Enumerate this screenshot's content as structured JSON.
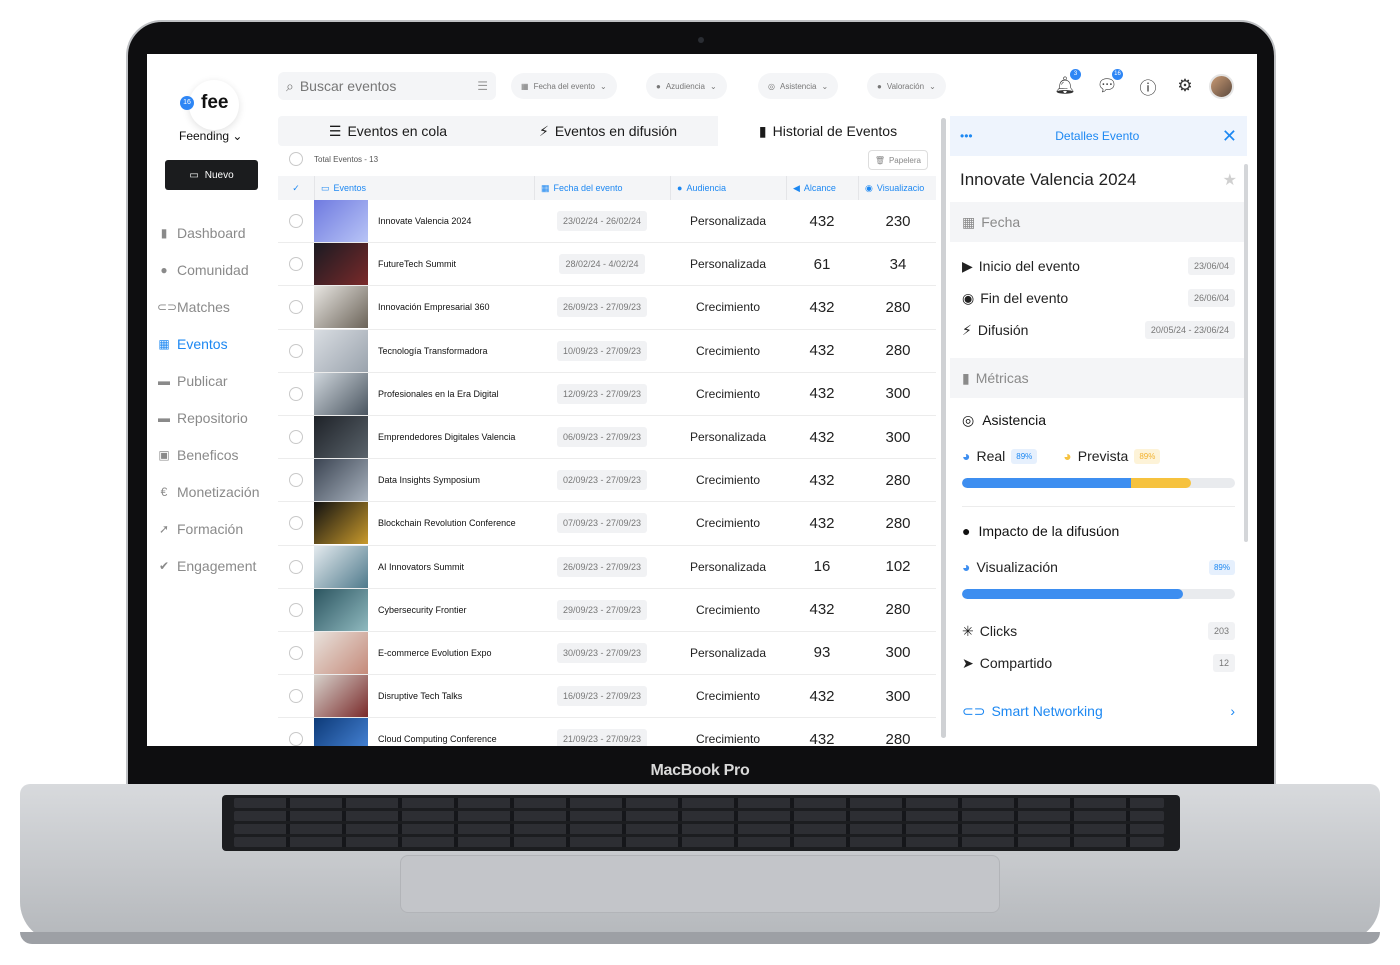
{
  "device": {
    "label": "MacBook Pro"
  },
  "brand": {
    "logo_text": "fee",
    "logo_badge": "16",
    "org_name": "Feending"
  },
  "sidebar": {
    "new_button": "Nuevo",
    "items": [
      {
        "label": "Dashboard",
        "icon": "bar-chart-icon"
      },
      {
        "label": "Comunidad",
        "icon": "users-icon"
      },
      {
        "label": "Matches",
        "icon": "link-icon"
      },
      {
        "label": "Eventos",
        "icon": "calendar-icon",
        "active": true
      },
      {
        "label": "Publicar",
        "icon": "publish-icon"
      },
      {
        "label": "Repositorio",
        "icon": "folder-icon"
      },
      {
        "label": "Beneficos",
        "icon": "gift-icon"
      },
      {
        "label": "Monetización",
        "icon": "euro-icon"
      },
      {
        "label": "Formación",
        "icon": "rocket-icon"
      },
      {
        "label": "Engagement",
        "icon": "shield-check-icon"
      }
    ]
  },
  "topbar": {
    "search_placeholder": "Buscar eventos",
    "filters": [
      "Fecha del evento",
      "Azudiencia",
      "Asistencia",
      "Valoración"
    ],
    "notifications_count": "3",
    "messages_count": "16"
  },
  "tabs": [
    {
      "label": "Eventos en cola",
      "icon": "list-icon"
    },
    {
      "label": "Eventos en difusión",
      "icon": "bolt-icon"
    },
    {
      "label": "Historial de Eventos",
      "icon": "book-icon",
      "active": true
    }
  ],
  "table": {
    "total_label": "Total Eventos - 13",
    "trash_label": "Papelera",
    "columns": [
      "Eventos",
      "Fecha del evento",
      "Audiencia",
      "Alcance",
      "Visualizacio"
    ],
    "rows": [
      {
        "name": "Innovate Valencia 2024",
        "date": "23/02/24 - 26/02/24",
        "audience": "Personalizada",
        "reach": "432",
        "views": "230",
        "color1": "#6f7ae0",
        "color2": "#b8c4f6"
      },
      {
        "name": "FutureTech Summit",
        "date": "28/02/24 - 4/02/24",
        "audience": "Personalizada",
        "reach": "61",
        "views": "34",
        "color1": "#1a1a22",
        "color2": "#7a2a2a"
      },
      {
        "name": "Innovación Empresarial 360",
        "date": "26/09/23 - 27/09/23",
        "audience": "Crecimiento",
        "reach": "432",
        "views": "280",
        "color1": "#e8e6e2",
        "color2": "#6b6358"
      },
      {
        "name": "Tecnología Transformadora",
        "date": "10/09/23 - 27/09/23",
        "audience": "Crecimiento",
        "reach": "432",
        "views": "280",
        "color1": "#d9dde2",
        "color2": "#9aa3ad"
      },
      {
        "name": "Profesionales en la Era Digital",
        "date": "12/09/23 - 27/09/23",
        "audience": "Crecimiento",
        "reach": "432",
        "views": "300",
        "color1": "#cfd6dc",
        "color2": "#4a5560"
      },
      {
        "name": "Emprendedores Digitales Valencia",
        "date": "06/09/23 - 27/09/23",
        "audience": "Personalizada",
        "reach": "432",
        "views": "300",
        "color1": "#1e2228",
        "color2": "#5a636b"
      },
      {
        "name": "Data Insights Symposium",
        "date": "02/09/23 - 27/09/23",
        "audience": "Crecimiento",
        "reach": "432",
        "views": "280",
        "color1": "#3b4452",
        "color2": "#a8b2be"
      },
      {
        "name": "Blockchain Revolution Conference",
        "date": "07/09/23 - 27/09/23",
        "audience": "Crecimiento",
        "reach": "432",
        "views": "280",
        "color1": "#111111",
        "color2": "#c99a2c"
      },
      {
        "name": "AI Innovators Summit",
        "date": "26/09/23 - 27/09/23",
        "audience": "Personalizada",
        "reach": "16",
        "views": "102",
        "color1": "#e4eaee",
        "color2": "#4f7a8c"
      },
      {
        "name": "Cybersecurity Frontier",
        "date": "29/09/23 - 27/09/23",
        "audience": "Crecimiento",
        "reach": "432",
        "views": "280",
        "color1": "#2c5560",
        "color2": "#8fb9bf"
      },
      {
        "name": "E-commerce Evolution Expo",
        "date": "30/09/23 - 27/09/23",
        "audience": "Personalizada",
        "reach": "93",
        "views": "300",
        "color1": "#e8e2dc",
        "color2": "#c58a7a"
      },
      {
        "name": "Disruptive Tech Talks",
        "date": "16/09/23 - 27/09/23",
        "audience": "Crecimiento",
        "reach": "432",
        "views": "300",
        "color1": "#d7d2cc",
        "color2": "#7a2a2a"
      },
      {
        "name": "Cloud Computing Conference",
        "date": "21/09/23 - 27/09/23",
        "audience": "Crecimiento",
        "reach": "432",
        "views": "280",
        "color1": "#0d3a78",
        "color2": "#4c8be0"
      }
    ]
  },
  "details": {
    "header": "Detalles Evento",
    "title": "Innovate Valencia 2024",
    "fecha_label": "Fecha",
    "inicio_label": "Inicio del evento",
    "inicio_value": "23/06/04",
    "fin_label": "Fin del evento",
    "fin_value": "26/06/04",
    "difusion_label": "Difusión",
    "difusion_value": "20/05/24 - 23/06/24",
    "metricas_label": "Métricas",
    "asistencia_label": "Asistencia",
    "real_label": "Real",
    "real_pct": "89%",
    "prevista_label": "Prevista",
    "prevista_pct": "89%",
    "asistencia_real_fraction": 0.62,
    "asistencia_prevista_fraction": 0.84,
    "impacto_label": "Impacto de la difusúon",
    "visualizacion_label": "Visualización",
    "visualizacion_pct": "89%",
    "visualizacion_fraction": 0.81,
    "clicks_label": "Clicks",
    "clicks_value": "203",
    "compartido_label": "Compartido",
    "compartido_value": "12",
    "smart_networking_label": "Smart Networking"
  },
  "colors": {
    "accent": "#1d88f2",
    "yellow": "#f6c23e",
    "dark_button": "#1b1c1e"
  }
}
